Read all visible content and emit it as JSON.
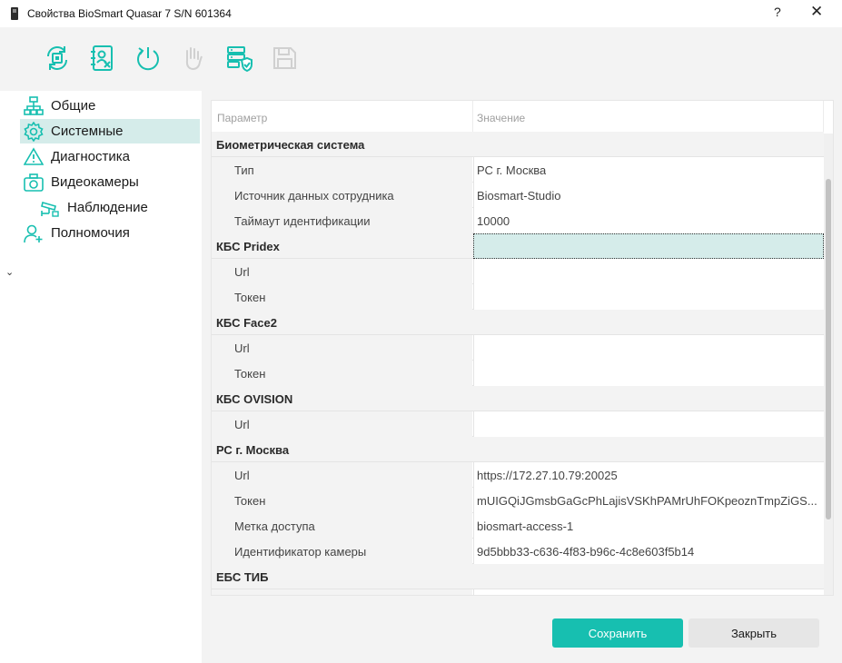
{
  "window": {
    "title": "Свойства BioSmart Quasar 7 S/N 601364",
    "help_label": "?",
    "close_label": "✕"
  },
  "toolbar": {
    "buttons": [
      {
        "icon": "sync-chip-icon",
        "enabled": true
      },
      {
        "icon": "contact-remove-icon",
        "enabled": true
      },
      {
        "icon": "power-restart-icon",
        "enabled": true
      },
      {
        "icon": "hand-icon",
        "enabled": false
      },
      {
        "icon": "server-shield-icon",
        "enabled": true
      },
      {
        "icon": "save-disk-icon",
        "enabled": false
      }
    ],
    "accent": "#17bfb0"
  },
  "sidebar": {
    "items": [
      {
        "label": "Общие",
        "icon": "network-tree-icon",
        "selected": false
      },
      {
        "label": "Системные",
        "icon": "gear-icon",
        "selected": true
      },
      {
        "label": "Диагностика",
        "icon": "warning-triangle-icon",
        "selected": false
      },
      {
        "label": "Видеокамеры",
        "icon": "camera-icon",
        "selected": false,
        "expanded": true
      },
      {
        "label": "Наблюдение",
        "icon": "cctv-icon",
        "selected": false,
        "child": true
      },
      {
        "label": "Полномочия",
        "icon": "user-add-icon",
        "selected": false
      }
    ]
  },
  "grid": {
    "header": {
      "param": "Параметр",
      "value": "Значение"
    },
    "rows": [
      {
        "type": "group",
        "title": "Биометрическая система"
      },
      {
        "type": "prop",
        "name": "Тип",
        "value": "РС г. Москва"
      },
      {
        "type": "prop",
        "name": "Источник данных сотрудника",
        "value": "Biosmart-Studio"
      },
      {
        "type": "prop",
        "name": "Таймаут идентификации",
        "value": "10000"
      },
      {
        "type": "group",
        "title": "КБС Pridex",
        "selected": true
      },
      {
        "type": "prop",
        "name": "Url",
        "value": ""
      },
      {
        "type": "prop",
        "name": "Токен",
        "value": ""
      },
      {
        "type": "group",
        "title": "КБС Face2"
      },
      {
        "type": "prop",
        "name": "Url",
        "value": ""
      },
      {
        "type": "prop",
        "name": "Токен",
        "value": ""
      },
      {
        "type": "group",
        "title": "КБС OVISION"
      },
      {
        "type": "prop",
        "name": "Url",
        "value": ""
      },
      {
        "type": "group",
        "title": "РС г. Москва"
      },
      {
        "type": "prop",
        "name": "Url",
        "value": "https://172.27.10.79:20025"
      },
      {
        "type": "prop",
        "name": "Токен",
        "value": "mUIGQiJGmsbGaGcPhLajisVSKhPAMrUhFOKpeoznTmpZiGS..."
      },
      {
        "type": "prop",
        "name": "Метка доступа",
        "value": "biosmart-access-1"
      },
      {
        "type": "prop",
        "name": "Идентификатор камеры",
        "value": "9d5bbb33-c636-4f83-b96c-4c8e603f5b14"
      },
      {
        "type": "group",
        "title": "ЕБС ТИБ"
      },
      {
        "type": "prop",
        "name": "",
        "value": ""
      }
    ]
  },
  "footer": {
    "save_label": "Сохранить",
    "close_label": "Закрыть"
  }
}
